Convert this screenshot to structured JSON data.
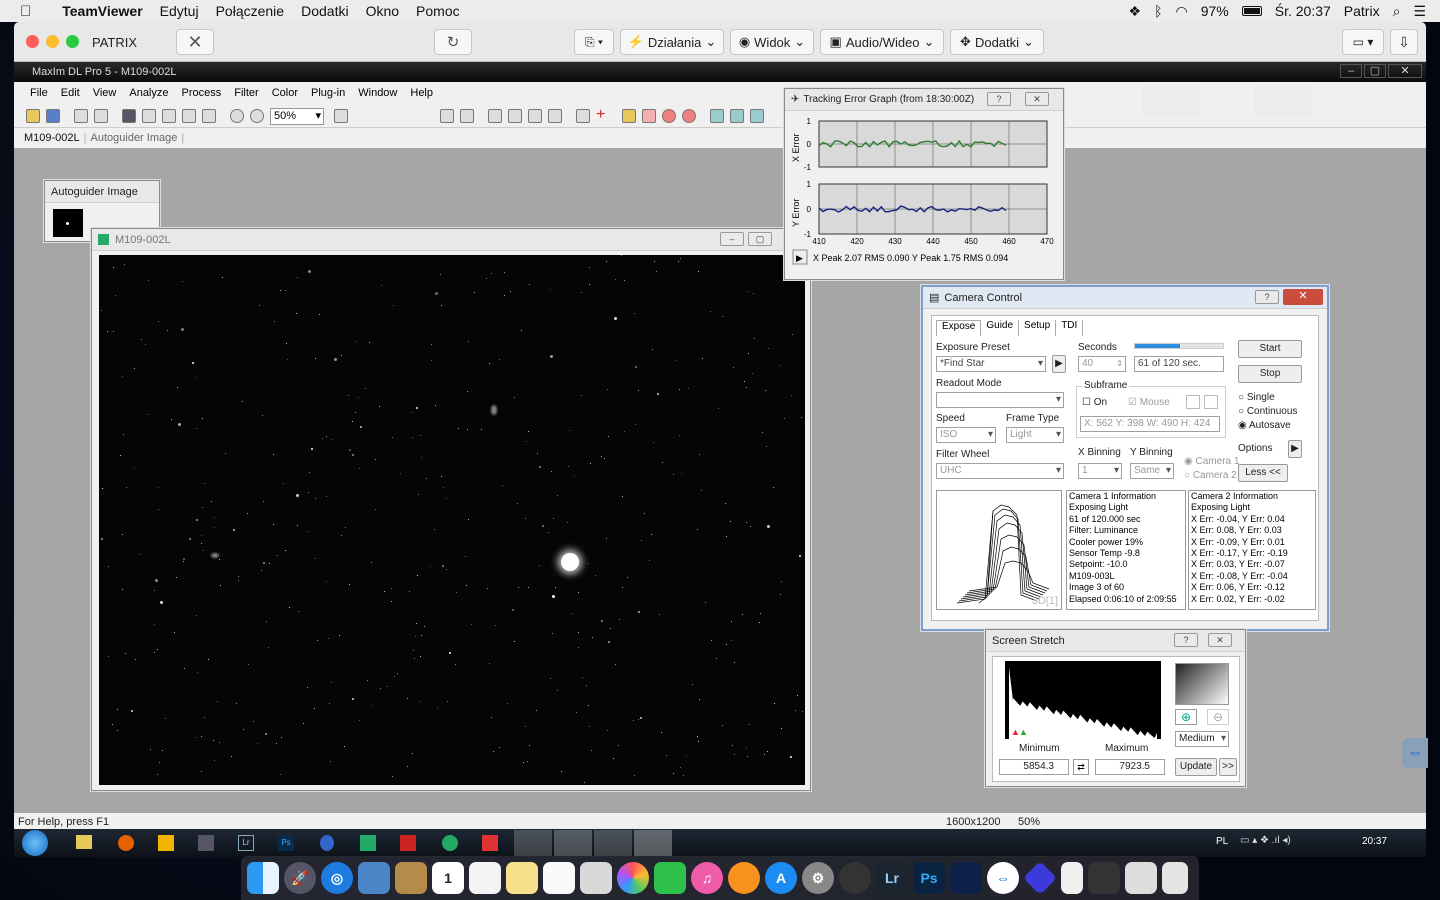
{
  "mac_menubar": {
    "apple": "",
    "app": "TeamViewer",
    "items": [
      "Edytuj",
      "Połączenie",
      "Dodatki",
      "Okno",
      "Pomoc"
    ],
    "battery": "97%",
    "clock": "Śr. 20:37",
    "user": "Patrix"
  },
  "teamviewer": {
    "partner": "PATRIX",
    "actions_label": "Działania",
    "view_label": "Widok",
    "av_label": "Audio/Wideo",
    "extras_label": "Dodatki"
  },
  "maxim": {
    "title": "MaxIm DL Pro 5 - M109-002L",
    "menu": [
      "File",
      "Edit",
      "View",
      "Analyze",
      "Process",
      "Filter",
      "Color",
      "Plug-in",
      "Window",
      "Help"
    ],
    "zoom": "50%",
    "tabs": [
      "M109-002L",
      "Autoguider Image"
    ],
    "status_help": "For Help, press F1",
    "status_size": "1600x1200",
    "status_zoom": "50%"
  },
  "autoguider": {
    "title": "Autoguider Image"
  },
  "image_window": {
    "title": "M109-002L"
  },
  "tracking": {
    "title": "Tracking Error Graph (from 18:30:00Z)",
    "x_label": "X Error",
    "y_label": "Y Error",
    "x_ticks": [
      "410",
      "420",
      "430",
      "440",
      "450",
      "460",
      "470"
    ],
    "y_ticks": [
      "1",
      "0",
      "-1"
    ],
    "stats": "X Peak 2.07   RMS 0.090    Y Peak 1.75   RMS 0.094"
  },
  "camera": {
    "title": "Camera Control",
    "tabs": [
      "Expose",
      "Guide",
      "Setup",
      "TDI"
    ],
    "exposure_preset_label": "Exposure Preset",
    "exposure_preset": "*Find Star",
    "seconds_label": "Seconds",
    "seconds": "40",
    "progress_text": "61 of 120 sec.",
    "progress": 0.51,
    "readout_label": "Readout Mode",
    "subframe_label": "Subframe",
    "on_label": "On",
    "mouse_label": "Mouse",
    "subframe_coords": "X: 562 Y: 398 W: 490 H: 424",
    "speed_label": "Speed",
    "speed": "ISO",
    "frame_type_label": "Frame Type",
    "frame_type": "Light",
    "filter_label": "Filter Wheel",
    "filter": "UHC",
    "xbin_label": "X Binning",
    "xbin": "1",
    "ybin_label": "Y Binning",
    "ybin": "Same",
    "camera1_opt": "Camera 1",
    "camera2_opt": "Camera 2",
    "start": "Start",
    "stop": "Stop",
    "single": "Single",
    "continuous": "Continuous",
    "autosave": "Autosave",
    "options": "Options",
    "less": "Less <<",
    "plot_label": "3D[1]",
    "cam1_info": [
      "Camera 1 Information",
      "Exposing Light",
      "61 of 120.000 sec",
      "Filter: Luminance",
      "Cooler power 19%",
      "Sensor Temp -9.8",
      "Setpoint: -10.0",
      "M109-003L",
      "Image 3 of 60",
      "Elapsed 0:06:10 of 2:09:55"
    ],
    "cam2_info": [
      "Camera 2 Information",
      "Exposing Light",
      "X Err: -0.04, Y Err: 0.04",
      "X Err: 0.08, Y Err: 0.03",
      "X Err: -0.09, Y Err: 0.01",
      "X Err: -0.17, Y Err: -0.19",
      "X Err: 0.03, Y Err: -0.07",
      "X Err: -0.08, Y Err: -0.04",
      "X Err: 0.06, Y Err: -0.12",
      "X Err: 0.02, Y Err: -0.02"
    ]
  },
  "stretch": {
    "title": "Screen Stretch",
    "minimum_label": "Minimum",
    "maximum_label": "Maximum",
    "minimum": "5854.3",
    "maximum": "7923.5",
    "preset": "Medium",
    "update": "Update",
    "more": ">>"
  },
  "win_taskbar": {
    "lang": "PL",
    "time": "20:37"
  },
  "colors": {
    "tv_blue": "#0e6fcf",
    "xerr": "#2e7d32",
    "yerr": "#1a237e"
  }
}
